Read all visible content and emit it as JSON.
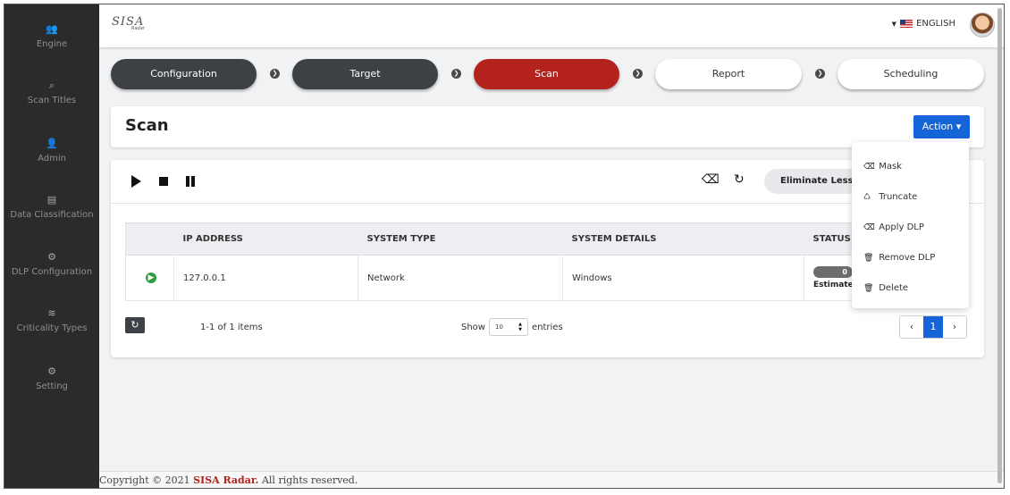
{
  "sidebar": {
    "items": [
      {
        "icon": "users-icon",
        "glyph": "👥",
        "label": "Engine"
      },
      {
        "icon": "search-icon",
        "glyph": "⌕",
        "label": "Scan Titles"
      },
      {
        "icon": "admin-icon",
        "glyph": "👤",
        "label": "Admin"
      },
      {
        "icon": "document-icon",
        "glyph": "▤",
        "label": "Data Classification"
      },
      {
        "icon": "gears-icon",
        "glyph": "⚙",
        "label": "DLP Configuration"
      },
      {
        "icon": "layers-icon",
        "glyph": "≋",
        "label": "Criticality Types"
      },
      {
        "icon": "gears-icon",
        "glyph": "⚙",
        "label": "Setting"
      }
    ]
  },
  "header": {
    "logo_text": "SISA",
    "logo_sub": "Radar",
    "language": "ENGLISH",
    "caret": "▼"
  },
  "steps": {
    "configuration": "Configuration",
    "target": "Target",
    "scan": "Scan",
    "report": "Report",
    "scheduling": "Scheduling",
    "arrow": "❯"
  },
  "scan_header": {
    "title": "Scan",
    "action": "Action ▾"
  },
  "toolbar": {
    "eraser_glyph": "⌫",
    "refresh_glyph": "↻",
    "eliminate": "Eliminate Less Than"
  },
  "table": {
    "columns": [
      "IP ADDRESS",
      "SYSTEM TYPE",
      "SYSTEM DETAILS",
      "STATUS"
    ],
    "rows": [
      {
        "status_icon": "play-circle-icon",
        "status_glyph": "▶",
        "ip": "127.0.0.1",
        "system_type": "Network",
        "system_details": "Windows",
        "progress": "0",
        "estimate": "Estimate"
      }
    ]
  },
  "pagination": {
    "refresh_glyph": "↻",
    "summary": "1-1 of 1 items",
    "show_label": "Show",
    "page_size": "10",
    "entries_label": "entries",
    "prev": "‹",
    "current": "1",
    "next": "›"
  },
  "action_menu": {
    "items": [
      {
        "icon": "eraser-icon",
        "glyph": "⌫",
        "label": "Mask"
      },
      {
        "icon": "recycle-icon",
        "glyph": "♺",
        "label": "Truncate"
      },
      {
        "icon": "eraser-icon",
        "glyph": "⌫",
        "label": "Apply DLP"
      },
      {
        "icon": "trash-icon",
        "glyph": "🗑",
        "label": "Remove DLP"
      },
      {
        "icon": "trash-icon",
        "glyph": "🗑",
        "label": "Delete"
      }
    ]
  },
  "footer": {
    "prefix": "Copyright © 2021 ",
    "brand": "SISA Radar.",
    "suffix": " All rights reserved."
  },
  "colors": {
    "accent": "#b3221c",
    "primary": "#1565d8",
    "sidebar": "#2b2b2b"
  }
}
